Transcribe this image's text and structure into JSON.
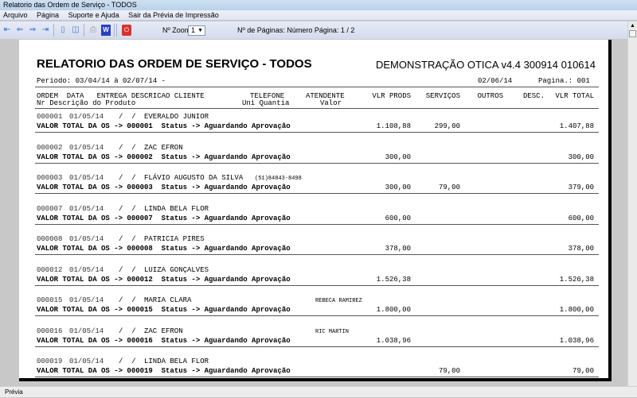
{
  "window": {
    "title": "Relatorio das Ordem de Serviço  - TODOS"
  },
  "menu": [
    "Arquivo",
    "Página",
    "Suporte e Ajuda",
    "Sair da Prévia de Impressão"
  ],
  "toolbar": {
    "zoom_label": "Nº Zoom",
    "zoom_value": "1",
    "pages_label": "Nº de Páginas: Número Página: 1 / 2"
  },
  "report": {
    "title": "RELATORIO DAS ORDEM DE SERVIÇO  - TODOS",
    "company": "DEMONSTRAÇÃO OTICA v4.4 300914 010614",
    "period": "Periodo: 03/04/14 à 02/07/14 -",
    "date": "02/06/14",
    "page": "Pagina.: 001",
    "header1": "ORDEM  DATA   ENTREGA DESCRICAO CLIENTE",
    "header1b": "TELEFONE",
    "header1c": "ATENDENTE",
    "header2": "Nr Descrição do Produto",
    "header2b": "Uni Quantia",
    "header2c": "Valor",
    "cols": {
      "prods": "VLR PRODS",
      "servicos": "SERVIÇOS",
      "outros": "OUTROS",
      "desc": "DESC.",
      "total": "VLR TOTAL"
    },
    "records": [
      {
        "ordem": "000001",
        "data": "01/05/14",
        "entrega": "/  /",
        "cliente": "EVERALDO JUNIOR",
        "telefone": "",
        "atendente": "",
        "summary": "VALOR TOTAL DA OS -> 000001  Status -> Aguardando Aprovação",
        "prods": "1.108,88",
        "servicos": "299,00",
        "total": "1.407,88"
      },
      {
        "ordem": "000002",
        "data": "01/05/14",
        "entrega": "/  /",
        "cliente": "ZAC EFRON",
        "telefone": "",
        "atendente": "",
        "summary": "VALOR TOTAL DA OS -> 000002  Status -> Aguardando Aprovação",
        "prods": "300,00",
        "servicos": "",
        "total": "300,00"
      },
      {
        "ordem": "000003",
        "data": "01/05/14",
        "entrega": "/  /",
        "cliente": "FLÁVIO AUGUSTO DA SILVA",
        "telefone": "(51)84843-8498",
        "atendente": "",
        "summary": "VALOR TOTAL DA OS -> 000003  Status -> Aguardando Aprovação",
        "prods": "300,00",
        "servicos": "79,00",
        "total": "379,00"
      },
      {
        "ordem": "000007",
        "data": "01/05/14",
        "entrega": "/  /",
        "cliente": "LINDA BELA FLOR",
        "telefone": "",
        "atendente": "",
        "summary": "VALOR TOTAL DA OS -> 000007  Status -> Aguardando Aprovação",
        "prods": "600,00",
        "servicos": "",
        "total": "600,00"
      },
      {
        "ordem": "000008",
        "data": "01/05/14",
        "entrega": "/  /",
        "cliente": "PATRICIA PIRES",
        "telefone": "",
        "atendente": "",
        "summary": "VALOR TOTAL DA OS -> 000008  Status -> Aguardando Aprovação",
        "prods": "378,00",
        "servicos": "",
        "total": "378,00"
      },
      {
        "ordem": "000012",
        "data": "01/05/14",
        "entrega": "/  /",
        "cliente": "LUIZA GONÇALVES",
        "telefone": "",
        "atendente": "",
        "summary": "VALOR TOTAL DA OS -> 000012  Status -> Aguardando Aprovação",
        "prods": "1.526,38",
        "servicos": "",
        "total": "1.526,38"
      },
      {
        "ordem": "000015",
        "data": "01/05/14",
        "entrega": "/  /",
        "cliente": "MARIA CLARA",
        "telefone": "",
        "atendente": "REBECA RAMIREZ",
        "summary": "VALOR TOTAL DA OS -> 000015  Status -> Aguardando Aprovação",
        "prods": "1.800,00",
        "servicos": "",
        "total": "1.800,00"
      },
      {
        "ordem": "000016",
        "data": "01/05/14",
        "entrega": "/  /",
        "cliente": "ZAC EFRON",
        "telefone": "",
        "atendente": "RIC MARTIN",
        "summary": "VALOR TOTAL DA OS -> 000016  Status -> Aguardando Aprovação",
        "prods": "1.038,96",
        "servicos": "",
        "total": "1.038,96"
      },
      {
        "ordem": "000019",
        "data": "01/05/14",
        "entrega": "/  /",
        "cliente": "LINDA BELA FLOR",
        "telefone": "",
        "atendente": "",
        "summary": "VALOR TOTAL DA OS -> 000019  Status -> Aguardando Aprovação",
        "prods": "",
        "servicos": "79,00",
        "total": "79,00"
      }
    ]
  },
  "status": {
    "text": "Prévia"
  }
}
